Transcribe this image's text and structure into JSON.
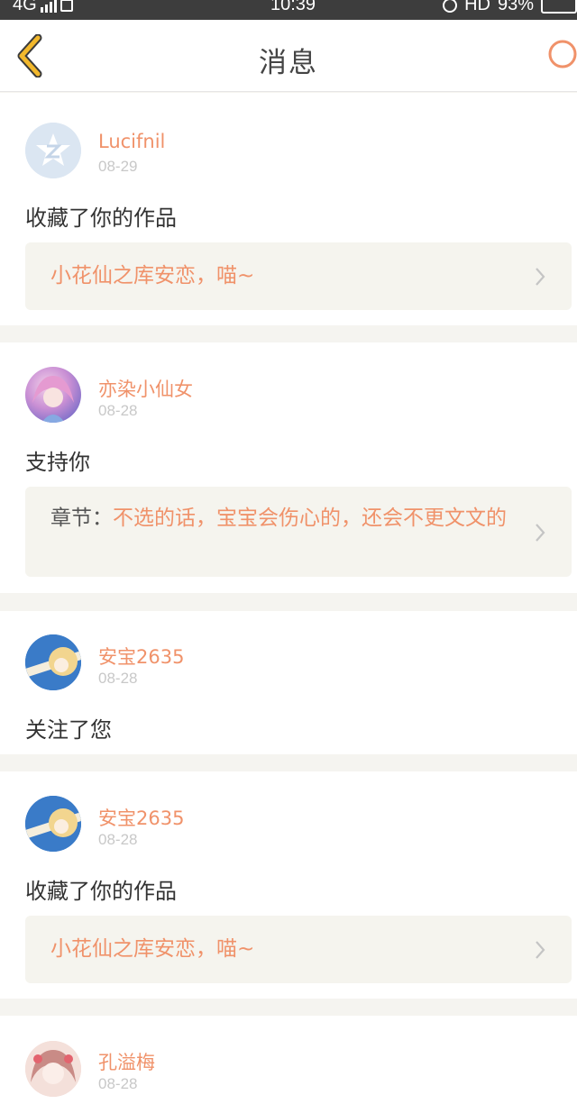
{
  "status_bar": {
    "network": "4G",
    "time": "10:39",
    "hd": "HD",
    "battery_pct": "93%"
  },
  "header": {
    "title": "消息"
  },
  "messages": [
    {
      "user": "Lucifnil",
      "date": "08-29",
      "action": "收藏了你的作品",
      "quote_prefix": "",
      "quote": "小花仙之库安恋，喵~"
    },
    {
      "user": "亦染小仙女",
      "date": "08-28",
      "action": "支持你",
      "quote_prefix": "章节：",
      "quote": "不选的话，宝宝会伤心的，还会不更文文的"
    },
    {
      "user": "安宝2635",
      "date": "08-28",
      "action": "关注了您"
    },
    {
      "user": "安宝2635",
      "date": "08-28",
      "action": "收藏了你的作品",
      "quote_prefix": "",
      "quote": "小花仙之库安恋，喵~"
    },
    {
      "user": "孔溢梅",
      "date": "08-28"
    }
  ],
  "colors": {
    "accent": "#f0926a",
    "back_arrow": "#f2b82c",
    "page_bg": "#f5f4f0",
    "quote_bg": "#f5f4ee"
  },
  "icons": [
    "back-chevron-icon",
    "search-icon",
    "qq-avatar-icon",
    "chevron-right-icon"
  ]
}
